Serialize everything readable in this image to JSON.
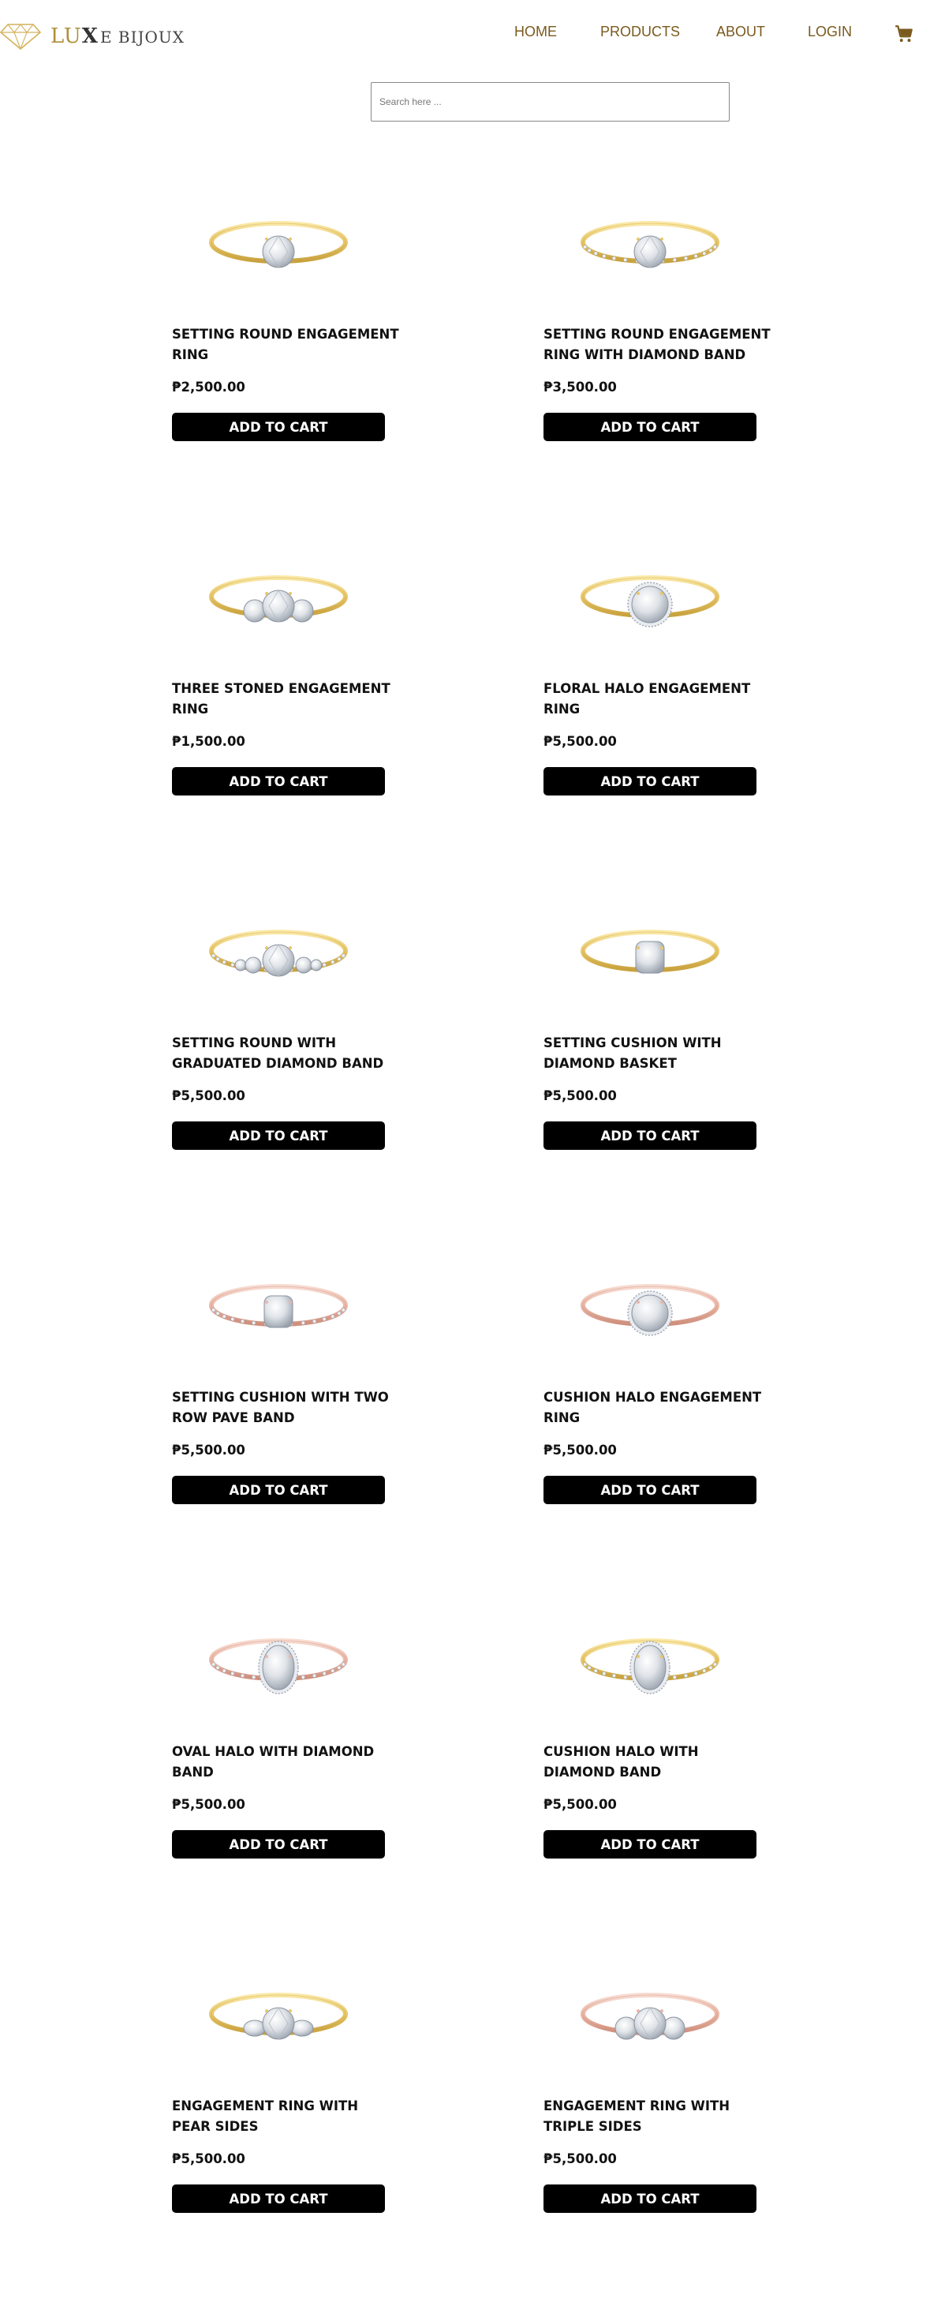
{
  "header": {
    "logo": {
      "part1": "LU",
      "part2": "X",
      "part3": "E BIJOUX"
    },
    "nav": {
      "home": "HOME",
      "products": "PRODUCTS",
      "about": "ABOUT",
      "login": "LOGIN"
    },
    "cart_icon": "cart-icon"
  },
  "search": {
    "placeholder": "Search here ..."
  },
  "colors": {
    "gold": "#b08e3a",
    "nav": "#7a5a1e",
    "button": "#000000",
    "button_text": "#ffffff",
    "rose": "#d9a08f"
  },
  "products": [
    {
      "name": "SETTING ROUND ENGAGEMENT RING",
      "price": "₱2,500.00",
      "button": "ADD TO CART",
      "metal": "gold",
      "stone": "round"
    },
    {
      "name": "SETTING ROUND ENGAGEMENT RING WITH DIAMOND BAND",
      "price": "₱3,500.00",
      "button": "ADD TO CART",
      "metal": "gold",
      "stone": "round-pave"
    },
    {
      "name": "THREE STONED ENGAGEMENT RING",
      "price": "₱1,500.00",
      "button": "ADD TO CART",
      "metal": "gold",
      "stone": "three"
    },
    {
      "name": "FLORAL HALO ENGAGEMENT RING",
      "price": "₱5,500.00",
      "button": "ADD TO CART",
      "metal": "gold",
      "stone": "halo"
    },
    {
      "name": "SETTING ROUND WITH GRADUATED DIAMOND BAND",
      "price": "₱5,500.00",
      "button": "ADD TO CART",
      "metal": "gold",
      "stone": "graduated"
    },
    {
      "name": "SETTING CUSHION WITH DIAMOND BASKET",
      "price": "₱5,500.00",
      "button": "ADD TO CART",
      "metal": "gold",
      "stone": "cushion"
    },
    {
      "name": "SETTING CUSHION WITH TWO ROW PAVE BAND",
      "price": "₱5,500.00",
      "button": "ADD TO CART",
      "metal": "rose",
      "stone": "cushion-pave"
    },
    {
      "name": "CUSHION HALO ENGAGEMENT RING",
      "price": "₱5,500.00",
      "button": "ADD TO CART",
      "metal": "rose",
      "stone": "halo"
    },
    {
      "name": "OVAL HALO WITH DIAMOND BAND",
      "price": "₱5,500.00",
      "button": "ADD TO CART",
      "metal": "rose",
      "stone": "oval-halo"
    },
    {
      "name": "CUSHION HALO WITH DIAMOND BAND",
      "price": "₱5,500.00",
      "button": "ADD TO CART",
      "metal": "gold",
      "stone": "oval-halo"
    },
    {
      "name": "ENGAGEMENT RING WITH PEAR SIDES",
      "price": "₱5,500.00",
      "button": "ADD TO CART",
      "metal": "gold",
      "stone": "pear"
    },
    {
      "name": "ENGAGEMENT RING WITH TRIPLE SIDES",
      "price": "₱5,500.00",
      "button": "ADD TO CART",
      "metal": "rose",
      "stone": "triple"
    }
  ]
}
